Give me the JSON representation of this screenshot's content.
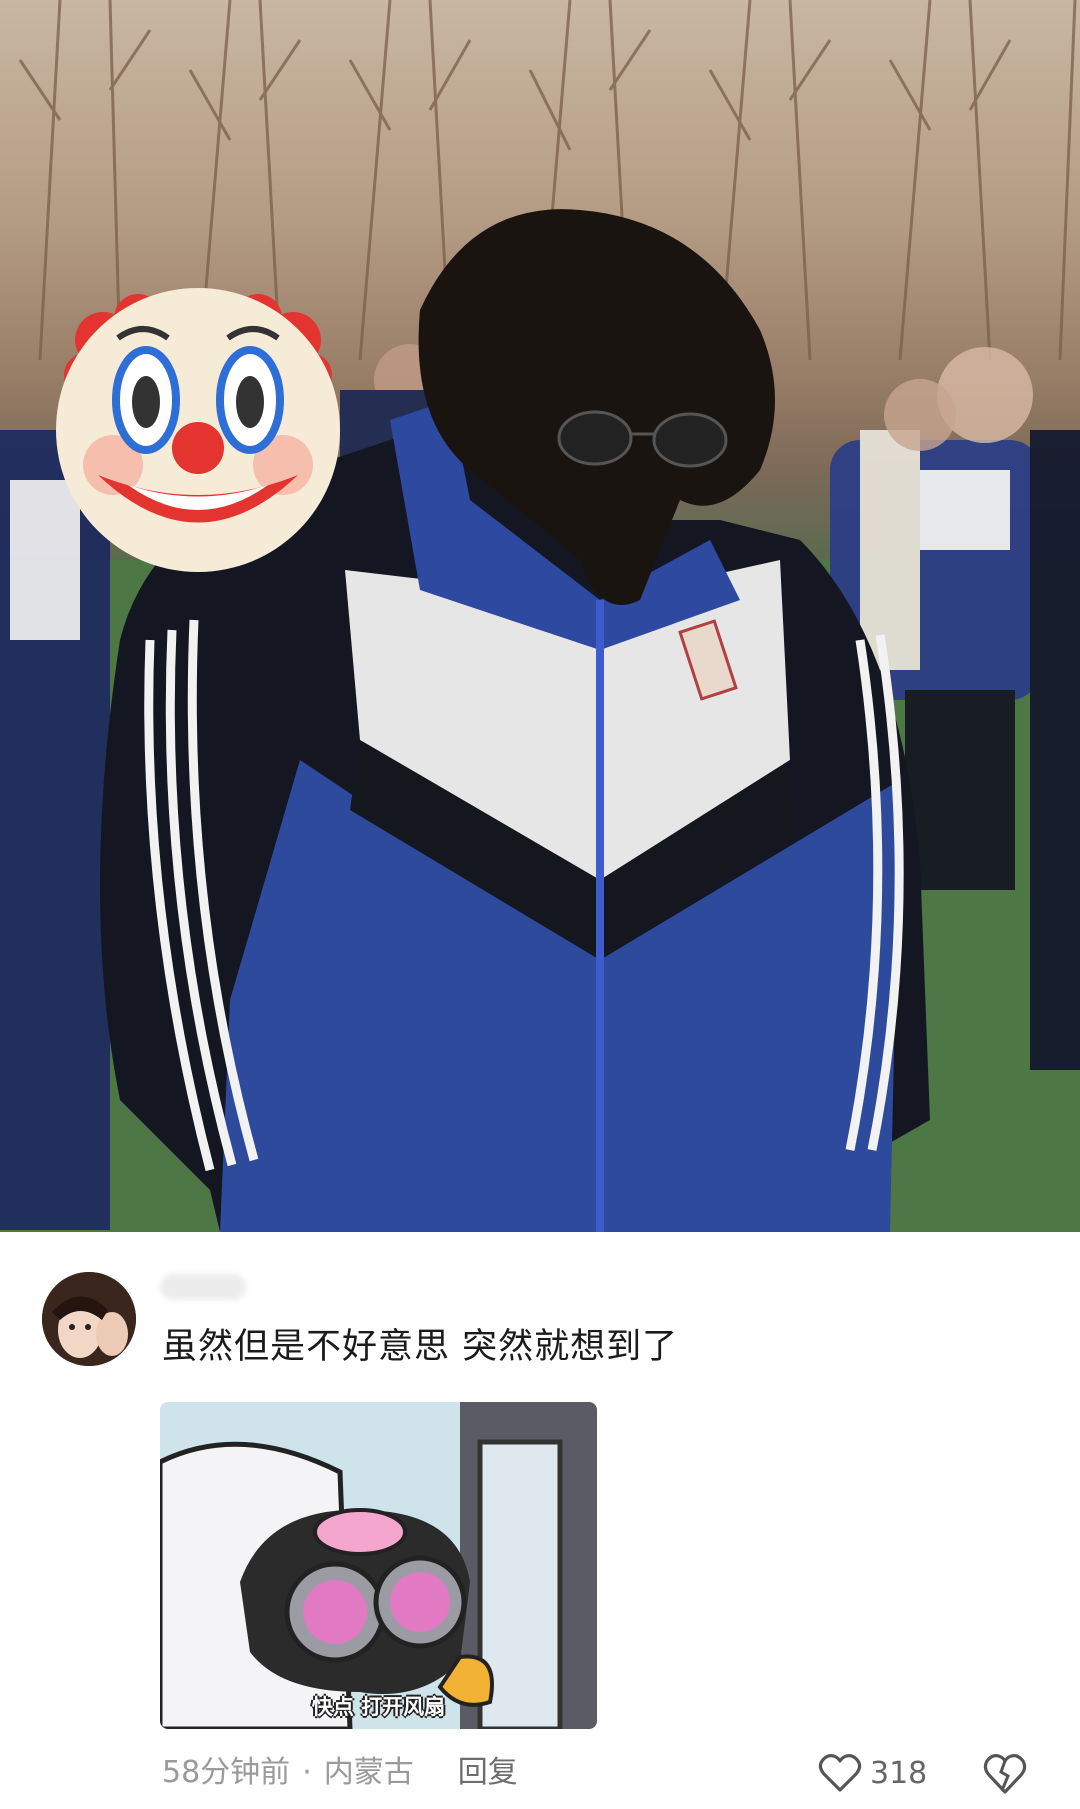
{
  "post": {
    "photo_icon": "clown-face-emoji"
  },
  "comment": {
    "avatar_icon": "user-avatar",
    "text": "虽然但是不好意思 突然就想到了",
    "sticker": {
      "caption": "快点 打开风扇"
    },
    "time": "58分钟前",
    "separator": "·",
    "location": "内蒙古",
    "reply_label": "回复",
    "like_icon": "heart-outline-icon",
    "like_count": "318",
    "dislike_icon": "broken-heart-icon"
  }
}
